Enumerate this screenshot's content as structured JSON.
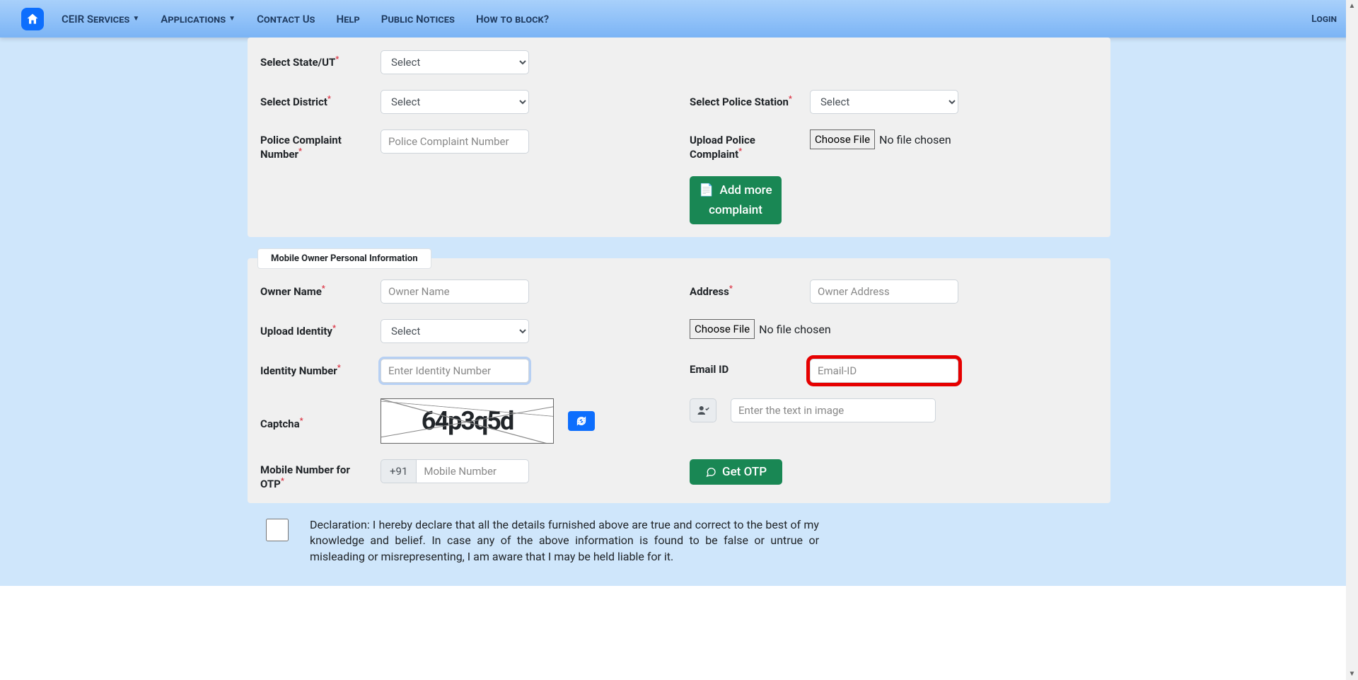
{
  "nav": {
    "items": [
      "CEIR Services",
      "Applications",
      "Contact Us",
      "Help",
      "Public Notices",
      "How to block?"
    ],
    "login": "Login"
  },
  "lost_info": {
    "state": {
      "label": "Select State/UT",
      "placeholder": "Select"
    },
    "district": {
      "label": "Select District",
      "placeholder": "Select"
    },
    "police_station": {
      "label": "Select Police Station",
      "placeholder": "Select"
    },
    "complaint_no": {
      "label": "Police Complaint Number",
      "placeholder": "Police Complaint Number"
    },
    "upload_complaint": {
      "label": "Upload Police Complaint",
      "choose": "Choose File",
      "nofile": "No file chosen"
    },
    "add_more": "Add more complaint"
  },
  "owner": {
    "legend": "Mobile Owner Personal Information",
    "name": {
      "label": "Owner Name",
      "placeholder": "Owner Name"
    },
    "address": {
      "label": "Address",
      "placeholder": "Owner Address"
    },
    "upload_identity": {
      "label": "Upload Identity",
      "placeholder": "Select",
      "choose": "Choose File",
      "nofile": "No file chosen"
    },
    "identity_no": {
      "label": "Identity Number",
      "placeholder": "Enter Identity Number"
    },
    "email": {
      "label": "Email ID",
      "placeholder": "Email-ID"
    },
    "captcha": {
      "label": "Captcha",
      "image_text": "64p3q5d",
      "placeholder": "Enter the text in image"
    },
    "otp_mobile": {
      "label": "Mobile Number for OTP",
      "prefix": "+91",
      "placeholder": "Mobile Number"
    },
    "get_otp": "Get OTP"
  },
  "declaration": "Declaration: I hereby declare that all the details furnished above are true and correct to the best of my knowledge and belief. In case any of the above information is found to be false or untrue or misleading or misrepresenting, I am aware that I may be held liable for it."
}
